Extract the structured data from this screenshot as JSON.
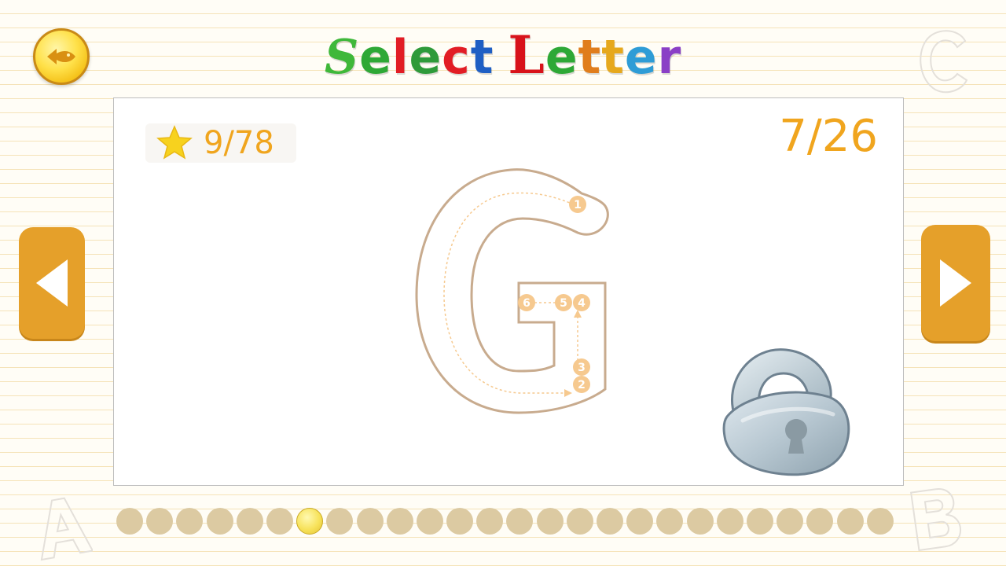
{
  "title": {
    "letters": [
      {
        "char": "S",
        "color": "#3fb83a"
      },
      {
        "char": "e",
        "color": "#2ea836"
      },
      {
        "char": "l",
        "color": "#e21d25"
      },
      {
        "char": "e",
        "color": "#2e9a3a"
      },
      {
        "char": "c",
        "color": "#e21d25"
      },
      {
        "char": "t",
        "color": "#1f5fc4"
      },
      {
        "char": " ",
        "color": "#000000"
      },
      {
        "char": "L",
        "color": "#d8121a"
      },
      {
        "char": "e",
        "color": "#2ea836"
      },
      {
        "char": "t",
        "color": "#e07d1c"
      },
      {
        "char": "t",
        "color": "#e6a81c"
      },
      {
        "char": "e",
        "color": "#2e9cd6"
      },
      {
        "char": "r",
        "color": "#8a3fc6"
      }
    ]
  },
  "stars": {
    "text": "9/78",
    "icon": "star-icon"
  },
  "page_counter": "7/26",
  "current_letter": "G",
  "locked": true,
  "stroke_steps": [
    "1",
    "2",
    "3",
    "4",
    "5",
    "6"
  ],
  "progress": {
    "total": 26,
    "current_index": 6
  },
  "icons": {
    "back": "fish-back-icon",
    "prev": "triangle-left-icon",
    "next": "triangle-right-icon",
    "lock": "padlock-icon"
  },
  "colors": {
    "accent": "#f0a51e",
    "nav_button": "#e5a02a",
    "dot_inactive": "#dccaa2",
    "dot_active": "#f7e25a",
    "letter_outline": "#c8ab8e",
    "step_badge": "#f6c98f"
  }
}
